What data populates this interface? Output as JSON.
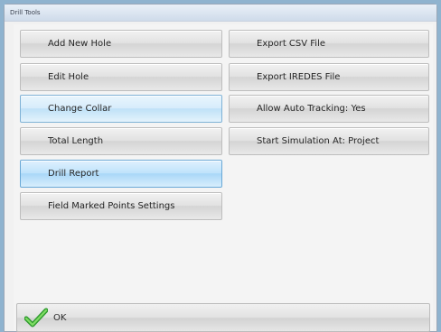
{
  "window": {
    "title": "Drill Tools"
  },
  "buttons": {
    "left": [
      {
        "label": "Add New Hole"
      },
      {
        "label": "Edit Hole"
      },
      {
        "label": "Change Collar"
      },
      {
        "label": "Total Length"
      },
      {
        "label": "Drill Report"
      },
      {
        "label": "Field Marked Points Settings"
      }
    ],
    "right": [
      {
        "label": "Export CSV File"
      },
      {
        "label": "Export IREDES File"
      },
      {
        "label": "Allow Auto Tracking: Yes"
      },
      {
        "label": "Start Simulation At: Project"
      }
    ]
  },
  "ok_button": {
    "label": "OK",
    "icon": "checkmark-icon"
  }
}
